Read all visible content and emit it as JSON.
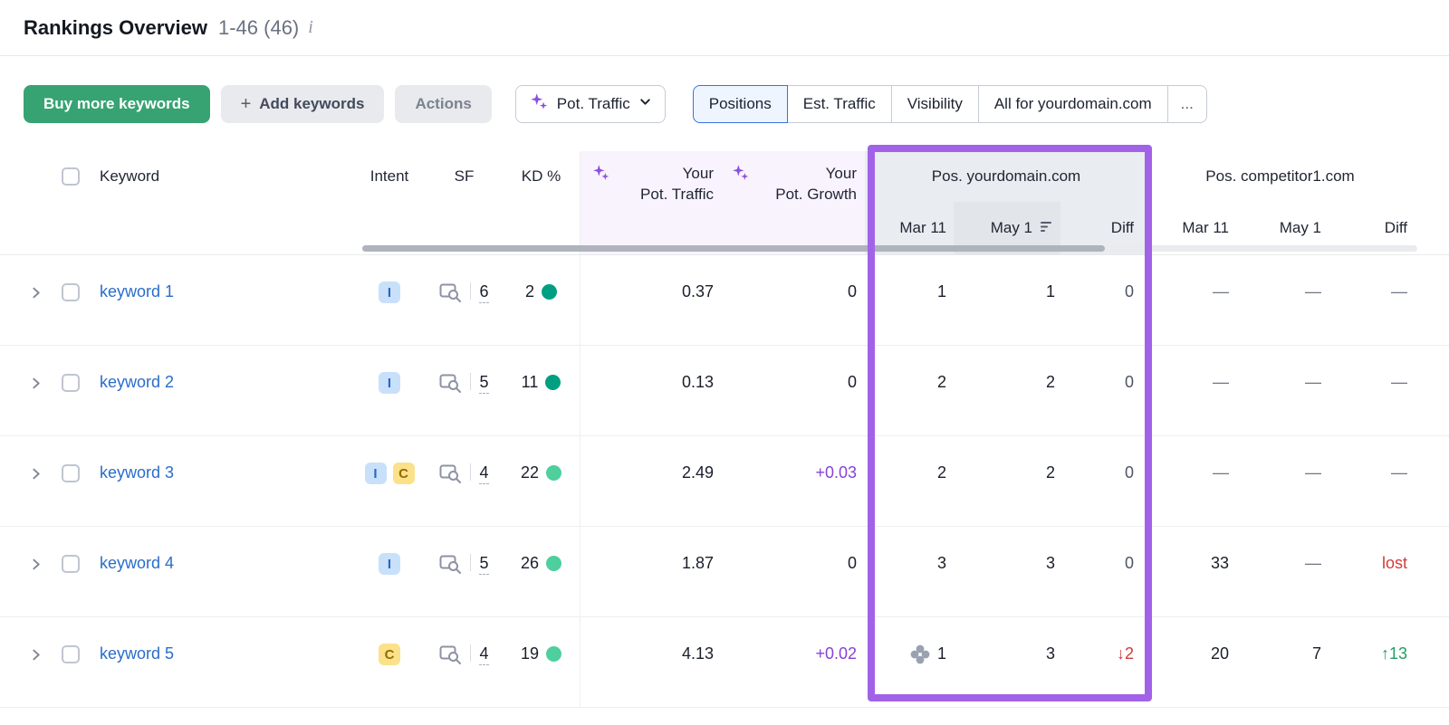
{
  "header": {
    "title": "Rankings Overview",
    "count": "1-46 (46)",
    "info_icon": "i"
  },
  "toolbar": {
    "buy_button": "Buy more keywords",
    "add_plus": "+",
    "add_button": "Add keywords",
    "actions_button": "Actions",
    "metric_dropdown": "Pot. Traffic",
    "tabs": [
      {
        "label": "Positions",
        "selected": true
      },
      {
        "label": "Est. Traffic",
        "selected": false
      },
      {
        "label": "Visibility",
        "selected": false
      },
      {
        "label": "All for yourdomain.com",
        "selected": false
      },
      {
        "label": "...",
        "selected": false
      }
    ]
  },
  "table": {
    "headers": {
      "keyword": "Keyword",
      "intent": "Intent",
      "sf": "SF",
      "kd": "KD %",
      "traffic_line1": "Your",
      "traffic_line2": "Pot. Traffic",
      "growth_line1": "Your",
      "growth_line2": "Pot. Growth",
      "group_yourdomain": "Pos. yourdomain.com",
      "group_competitor": "Pos. competitor1.com",
      "y_mar": "Mar 11",
      "y_may": "May 1",
      "y_diff": "Diff",
      "c_mar": "Mar 11",
      "c_may": "May 1",
      "c_diff": "Diff"
    },
    "rows": [
      {
        "keyword": "keyword 1",
        "intents": [
          "I"
        ],
        "sf": "6",
        "kd": "2",
        "pot_traffic": "0.37",
        "pot_growth": "0",
        "your": {
          "mar": "1",
          "may": "1",
          "diff": "0"
        },
        "comp": {
          "mar": "—",
          "may": "—",
          "diff": "—"
        }
      },
      {
        "keyword": "keyword 2",
        "intents": [
          "I"
        ],
        "sf": "5",
        "kd": "11",
        "pot_traffic": "0.13",
        "pot_growth": "0",
        "your": {
          "mar": "2",
          "may": "2",
          "diff": "0"
        },
        "comp": {
          "mar": "—",
          "may": "—",
          "diff": "—"
        }
      },
      {
        "keyword": "keyword 3",
        "intents": [
          "I",
          "C"
        ],
        "sf": "4",
        "kd": "22",
        "pot_traffic": "2.49",
        "pot_growth": "+0.03",
        "your": {
          "mar": "2",
          "may": "2",
          "diff": "0"
        },
        "comp": {
          "mar": "—",
          "may": "—",
          "diff": "—"
        }
      },
      {
        "keyword": "keyword 4",
        "intents": [
          "I"
        ],
        "sf": "5",
        "kd": "26",
        "pot_traffic": "1.87",
        "pot_growth": "0",
        "your": {
          "mar": "3",
          "may": "3",
          "diff": "0"
        },
        "comp": {
          "mar": "33",
          "may": "—",
          "diff": "lost"
        }
      },
      {
        "keyword": "keyword 5",
        "intents": [
          "C"
        ],
        "sf": "4",
        "kd": "19",
        "pot_traffic": "4.13",
        "pot_growth": "+0.02",
        "your": {
          "mar": "1",
          "may": "3",
          "diff": "↓2"
        },
        "comp": {
          "mar": "20",
          "may": "7",
          "diff": "↑13"
        }
      }
    ]
  },
  "colors": {
    "accent_green": "#37a372",
    "highlight_purple": "#a262e8",
    "ai_purple": "#8b4fe0",
    "positive_green": "#1f9e63",
    "negative_red": "#d13b3b",
    "kd_very_easy": "#009f81",
    "kd_easy": "#4ecf9d",
    "link_blue": "#2a6dc9",
    "selected_tab_border": "#3a72e3"
  }
}
